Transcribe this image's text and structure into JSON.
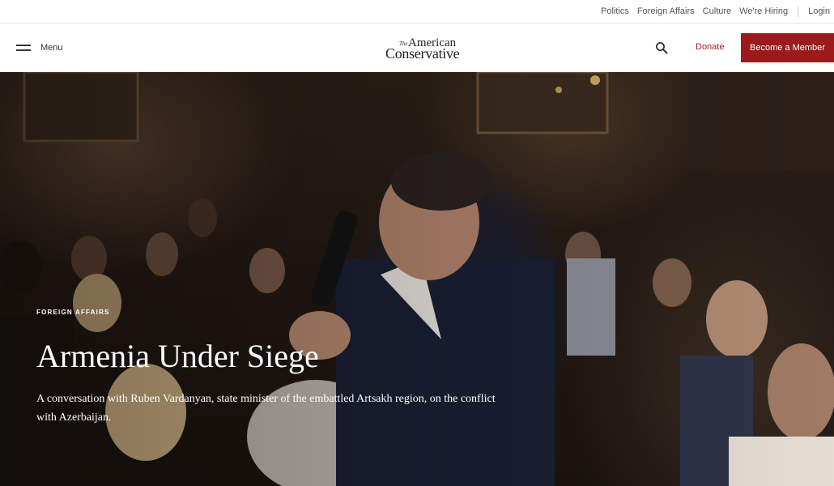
{
  "utility_nav": {
    "links": [
      "Politics",
      "Foreign Affairs",
      "Culture",
      "We're Hiring",
      "Login"
    ]
  },
  "header": {
    "menu_label": "Menu",
    "logo": {
      "the": "The",
      "american": "American",
      "conservative": "Conservative"
    },
    "donate_label": "Donate",
    "member_label": "Become a Member"
  },
  "hero": {
    "kicker": "FOREIGN AFFAIRS",
    "title": "Armenia Under Siege",
    "dek": "A conversation with Ruben Vardanyan, state minister of the embattled Artsakh region, on the conflict with Azerbaijan."
  },
  "colors": {
    "accent": "#9b1a1c",
    "donate": "#a51d21"
  },
  "icons": [
    "hamburger-icon",
    "search-icon"
  ]
}
